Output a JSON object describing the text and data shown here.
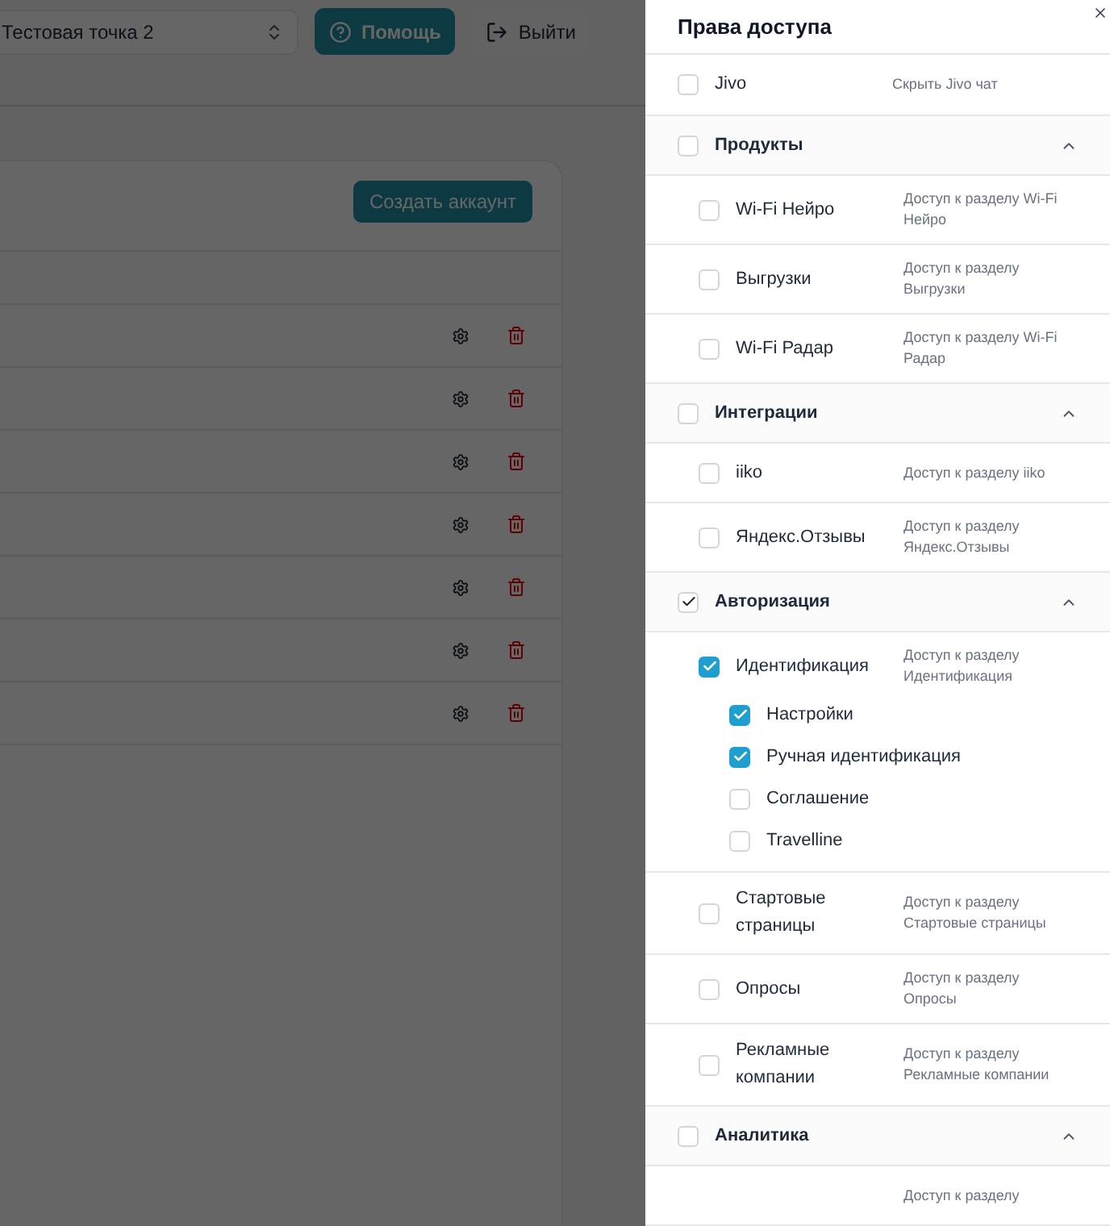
{
  "top_bar": {
    "location_select": "Тестовая точка 2",
    "help_button": "Помощь",
    "logout_button": "Выйти"
  },
  "accounts_card": {
    "create_button": "Создать аккаунт",
    "rows": [
      {
        "kind": "account"
      },
      {
        "kind": "account"
      },
      {
        "kind": "account"
      },
      {
        "kind": "account"
      },
      {
        "kind": "account"
      },
      {
        "kind": "account"
      },
      {
        "kind": "account"
      }
    ]
  },
  "access_drawer": {
    "title": "Права доступа",
    "items": [
      {
        "kind": "option",
        "label": "Jivo",
        "description": "Скрыть Jivo чат",
        "checked": false
      },
      {
        "kind": "group",
        "label": "Продукты",
        "checked": false,
        "expanded": true,
        "children": [
          {
            "label": "Wi-Fi Нейро",
            "description": "Доступ к разделу Wi-Fi Нейро",
            "checked": false
          },
          {
            "label": "Выгрузки",
            "description": "Доступ к разделу Выгрузки",
            "checked": false
          },
          {
            "label": "Wi-Fi Радар",
            "description": "Доступ к разделу Wi-Fi Радар",
            "checked": false
          }
        ]
      },
      {
        "kind": "group",
        "label": "Интеграции",
        "checked": false,
        "expanded": true,
        "children": [
          {
            "label": "iiko",
            "description": "Доступ к разделу iiko",
            "checked": false
          },
          {
            "label": "Яндекс.Отзывы",
            "description": "Доступ к разделу Яндекс.Отзывы",
            "checked": false
          }
        ]
      },
      {
        "kind": "group",
        "label": "Авторизация",
        "checked": true,
        "expanded": true,
        "children": [
          {
            "label": "Идентификация",
            "description": "Доступ к разделу Идентификация",
            "checked": true,
            "children": [
              {
                "label": "Настройки",
                "checked": true
              },
              {
                "label": "Ручная идентификация",
                "checked": true
              },
              {
                "label": "Соглашение",
                "checked": false
              },
              {
                "label": "Travelline",
                "checked": false
              }
            ]
          },
          {
            "label": "Стартовые страницы",
            "description": "Доступ к разделу Стартовые страницы",
            "checked": false
          },
          {
            "label": "Опросы",
            "description": "Доступ к разделу Опросы",
            "checked": false
          },
          {
            "label": "Рекламные компании",
            "description": "Доступ к разделу Рекламные компании",
            "checked": false
          }
        ]
      },
      {
        "kind": "group",
        "label": "Аналитика",
        "checked": false,
        "expanded": true,
        "children": [
          {
            "description": "Доступ к разделу"
          }
        ]
      }
    ]
  }
}
